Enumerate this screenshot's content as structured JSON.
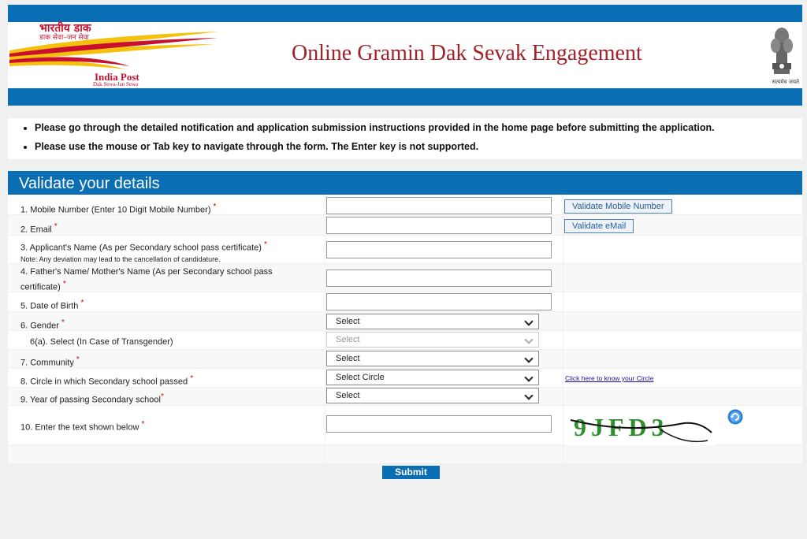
{
  "header": {
    "logo_hindi_line1": "भारतीय डाक",
    "logo_hindi_line2": "डाक सेवा–जन सेवा",
    "logo_text": "India Post",
    "logo_tagline": "Dak Sewa-Jan Sewa",
    "title": "Online Gramin Dak Sevak Engagement",
    "emblem_text": "सत्यमेव जयते"
  },
  "notices": [
    "Please go through the detailed notification and application submission instructions provided in the home page before submitting the application.",
    "Please use the mouse or Tab key to navigate through the form. The Enter key is not supported."
  ],
  "form": {
    "heading": "Validate your details",
    "fields": [
      {
        "label": "1. Mobile Number (Enter 10 Digit Mobile Number)",
        "required": "*",
        "value": ""
      },
      {
        "label": "2. Email",
        "required": "*",
        "value": ""
      },
      {
        "label": "3. Applicant's Name (As per Secondary school pass certificate)",
        "required": "*",
        "note": "Note: Any deviation may lead to the cancellation of candidature.",
        "value": ""
      },
      {
        "label": "4. Father's Name/ Mother's Name (As per Secondary school pass certificate)",
        "required": "*",
        "value": ""
      },
      {
        "label": "5. Date of Birth",
        "required": "*",
        "value": ""
      },
      {
        "label": "6. Gender",
        "required": "*",
        "selected": "Select"
      },
      {
        "label": "6(a). Select (In Case of Transgender)",
        "selected": "Select"
      },
      {
        "label": "7. Community",
        "required": "*",
        "selected": "Select"
      },
      {
        "label": "8. Circle in which Secondary school passed",
        "required": "*",
        "selected": "Select Circle"
      },
      {
        "label": "9. Year of passing Secondary school",
        "required": "*",
        "selected": "Select"
      },
      {
        "label": "10. Enter the text shown below",
        "required": "*",
        "value": ""
      }
    ],
    "validate_mobile_label": "Validate Mobile Number",
    "validate_email_label": "Validate eMail",
    "circle_link_label": "Click here to know your Circle",
    "captcha_text": "9JFD3",
    "submit_label": "Submit"
  },
  "colors": {
    "primary_blue": "#0a6eb4",
    "title_red": "#a0222a",
    "required_red": "#d00000"
  }
}
